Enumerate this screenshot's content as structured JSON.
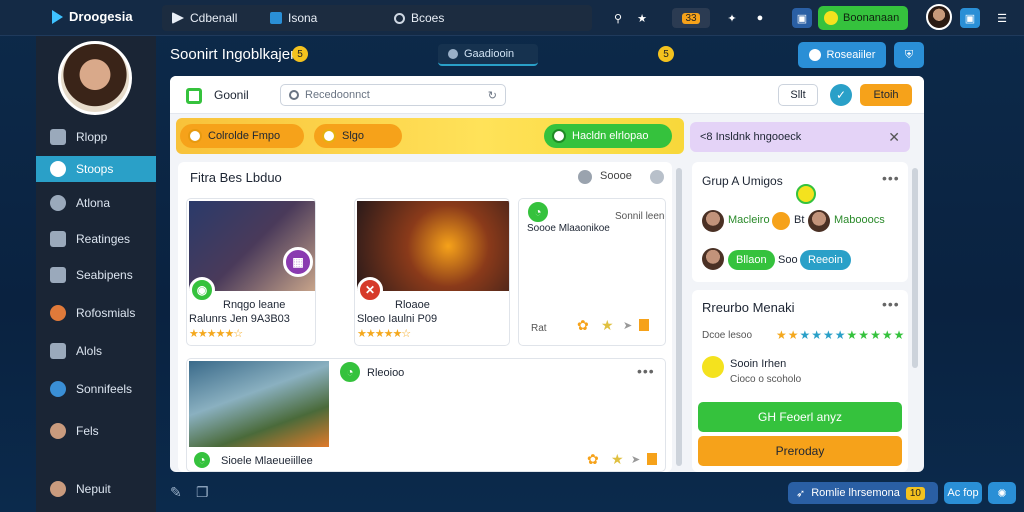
{
  "app": {
    "title": "Droogesia"
  },
  "topbar": {
    "tabs": [
      {
        "label": "Cdbenall"
      },
      {
        "label": "Isona"
      },
      {
        "label": "Bcoes"
      }
    ],
    "notification_count": "33",
    "action_label": "Boonanaan"
  },
  "sidebar": {
    "items": [
      {
        "label": "Rlopp"
      },
      {
        "label": "Stoops"
      },
      {
        "label": "Atlona"
      },
      {
        "label": "Reatinges"
      },
      {
        "label": "Seabipens"
      },
      {
        "label": "Rofosmials"
      },
      {
        "label": "Alols"
      },
      {
        "label": "Sonnifeels"
      },
      {
        "label": "Fels"
      },
      {
        "label": "Nepuit"
      }
    ]
  },
  "header": {
    "title": "Soonirt Ingoblkajer",
    "title_badge": "5",
    "center_tab": "Gaadiooin",
    "coin": "5",
    "btn_primary": "Roseaiiler"
  },
  "toolbar": {
    "label": "Goonil",
    "search_placeholder": "Recedoonnct",
    "filter_all": "Sllt",
    "action": "Etoih"
  },
  "filters": {
    "chip1": "Colrolde Fmpo",
    "chip2": "Slgo",
    "chip3": "Hacldn elrlopao",
    "right_bar": "<8 Insldnk hngooeck"
  },
  "feed": {
    "title": "Fitra Bes Lbduo",
    "status": "Soooe",
    "cards": [
      {
        "title": "Rnqgo leane",
        "subtitle": "Ralunrs Jen 9A3B03",
        "rating": "★★★★★☆"
      },
      {
        "title": "Rloaoe",
        "subtitle": "Sloeo Iaulni P09",
        "rating": "★★★★★☆"
      },
      {
        "title": "Soooe Mlaaonikoe",
        "subtitle": "Sonnil leene",
        "footer": "Rat",
        "rating": ""
      },
      {
        "title": "Rleoioo",
        "subtitle": "Sioele Mlaeueiillee",
        "rating": ""
      }
    ]
  },
  "right": {
    "group_title": "Grup A Umigos",
    "people": [
      {
        "name": "Macleiro",
        "tag": "Bt"
      },
      {
        "name": "Mabooocs",
        "tag": ""
      },
      {
        "name": "Reeoin",
        "tag": "Soo"
      },
      {
        "name": "Bllaon",
        "tag": ""
      }
    ],
    "ratings_title": "Rreurbo Menaki",
    "ratings_sub": "Dcoe lesoo",
    "stars": "★★★★★★★★★★★★★",
    "user_name": "Sooin Irhen",
    "user_sub": "Cioco o scoholo",
    "btn_green": "GH Feoerl anyz",
    "btn_orange": "Preroday"
  },
  "bottombar": {
    "pill_text": "Romlie lhrsemona",
    "pill_count": "10",
    "btn1": "Ac fop"
  },
  "colors": {
    "accent": "#2aa0c8",
    "green": "#35c23d",
    "orange": "#f6a21a",
    "yellow": "#f8c23a",
    "purple": "#e4d3f7"
  }
}
